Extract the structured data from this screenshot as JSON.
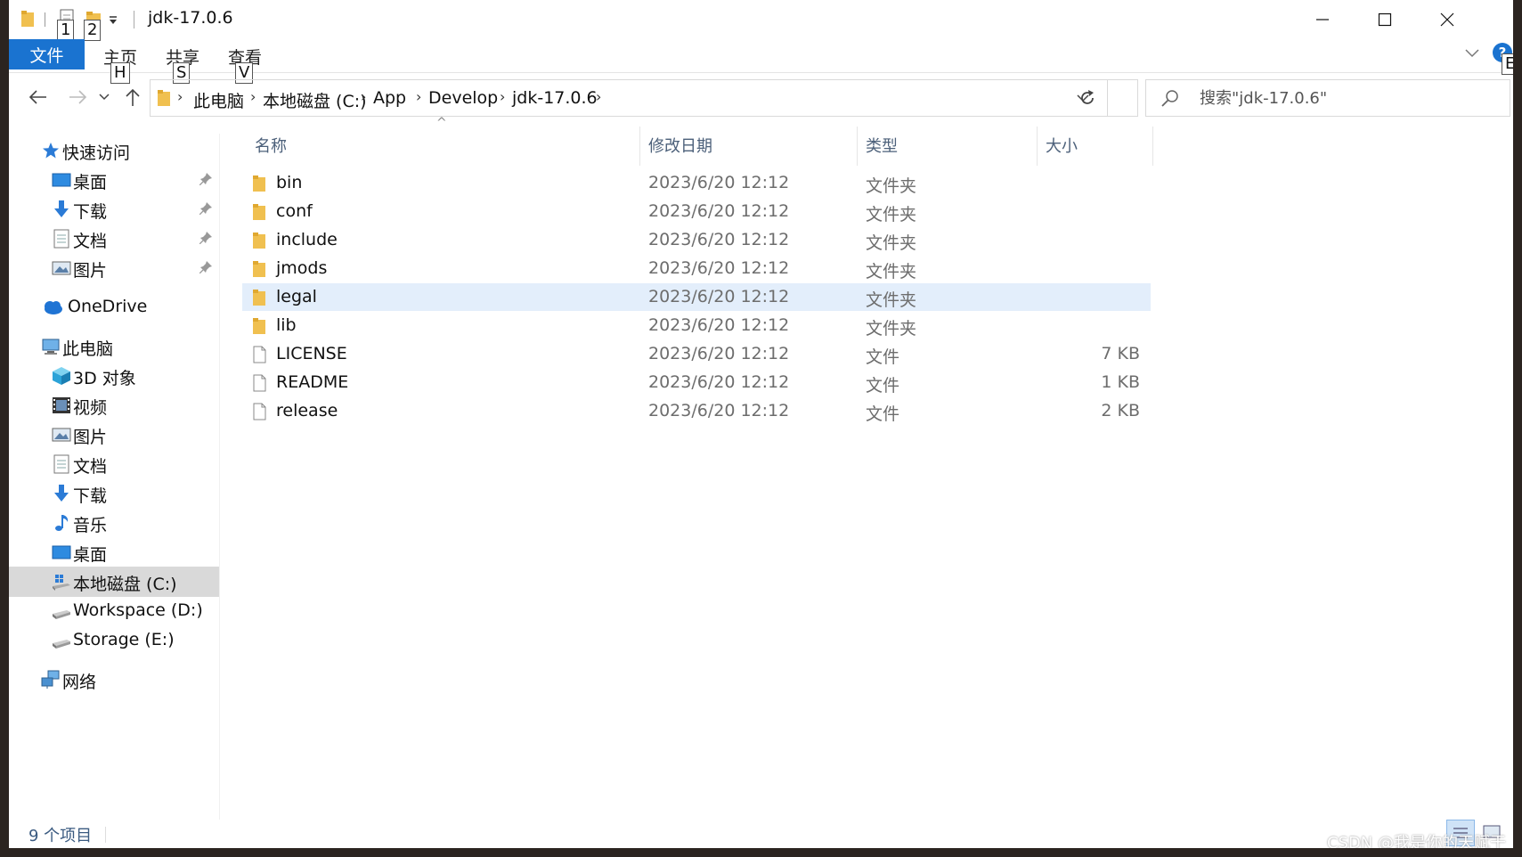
{
  "window": {
    "title": "jdk-17.0.6",
    "minimize_glyph": "—",
    "maximize_glyph": "☐",
    "close_glyph": "✕"
  },
  "key_tips": {
    "qat_1": "1",
    "qat_2": "2",
    "home": "H",
    "share": "S",
    "view": "V",
    "help": "E"
  },
  "ribbon": {
    "file": "文件",
    "tabs": [
      "主页",
      "共享",
      "查看"
    ],
    "expand_glyph": "﹀",
    "help_glyph": "?"
  },
  "nav": {
    "back_glyph": "←",
    "forward_glyph": "→",
    "recent_glyph": "˅",
    "up_glyph": "↑",
    "breadcrumb": [
      "此电脑",
      "本地磁盘 (C:)",
      "App",
      "Develop",
      "jdk-17.0.6"
    ],
    "crumb_sep": "›",
    "dropdown_glyph": "˅",
    "refresh_glyph": "↻",
    "search_placeholder": "搜索\"jdk-17.0.6\""
  },
  "sidebar": {
    "quick_access": {
      "label": "快速访问",
      "items": [
        {
          "label": "桌面",
          "icon": "desktop-icon",
          "pinned": true
        },
        {
          "label": "下载",
          "icon": "download-icon",
          "pinned": true
        },
        {
          "label": "文档",
          "icon": "document-icon",
          "pinned": true
        },
        {
          "label": "图片",
          "icon": "pictures-icon",
          "pinned": true
        }
      ]
    },
    "onedrive": {
      "label": "OneDrive",
      "icon": "cloud-icon"
    },
    "this_pc": {
      "label": "此电脑",
      "items": [
        {
          "label": "3D 对象",
          "icon": "cube-icon"
        },
        {
          "label": "视频",
          "icon": "video-icon"
        },
        {
          "label": "图片",
          "icon": "pictures-icon"
        },
        {
          "label": "文档",
          "icon": "document-icon"
        },
        {
          "label": "下载",
          "icon": "download-icon"
        },
        {
          "label": "音乐",
          "icon": "music-icon"
        },
        {
          "label": "桌面",
          "icon": "desktop-icon"
        },
        {
          "label": "本地磁盘 (C:)",
          "icon": "windows-drive-icon",
          "selected": true
        },
        {
          "label": "Workspace (D:)",
          "icon": "drive-icon"
        },
        {
          "label": "Storage (E:)",
          "icon": "drive-icon"
        }
      ]
    },
    "network": {
      "label": "网络",
      "icon": "network-icon"
    }
  },
  "columns": {
    "name": "名称",
    "date": "修改日期",
    "type": "类型",
    "size": "大小",
    "sort_glyph": "^"
  },
  "files": [
    {
      "name": "bin",
      "date": "2023/6/20 12:12",
      "type": "文件夹",
      "size": "",
      "kind": "folder"
    },
    {
      "name": "conf",
      "date": "2023/6/20 12:12",
      "type": "文件夹",
      "size": "",
      "kind": "folder"
    },
    {
      "name": "include",
      "date": "2023/6/20 12:12",
      "type": "文件夹",
      "size": "",
      "kind": "folder"
    },
    {
      "name": "jmods",
      "date": "2023/6/20 12:12",
      "type": "文件夹",
      "size": "",
      "kind": "folder"
    },
    {
      "name": "legal",
      "date": "2023/6/20 12:12",
      "type": "文件夹",
      "size": "",
      "kind": "folder",
      "selected": true
    },
    {
      "name": "lib",
      "date": "2023/6/20 12:12",
      "type": "文件夹",
      "size": "",
      "kind": "folder"
    },
    {
      "name": "LICENSE",
      "date": "2023/6/20 12:12",
      "type": "文件",
      "size": "7 KB",
      "kind": "file"
    },
    {
      "name": "README",
      "date": "2023/6/20 12:12",
      "type": "文件",
      "size": "1 KB",
      "kind": "file"
    },
    {
      "name": "release",
      "date": "2023/6/20 12:12",
      "type": "文件",
      "size": "2 KB",
      "kind": "file"
    }
  ],
  "status": {
    "count": "9 个项目",
    "watermark": "CSDN @我是你的天赋干"
  },
  "colors": {
    "accent": "#1a73d0",
    "folder": "#f0c050",
    "selected_row": "#e3eefb",
    "selected_side": "#d9d9d9"
  }
}
